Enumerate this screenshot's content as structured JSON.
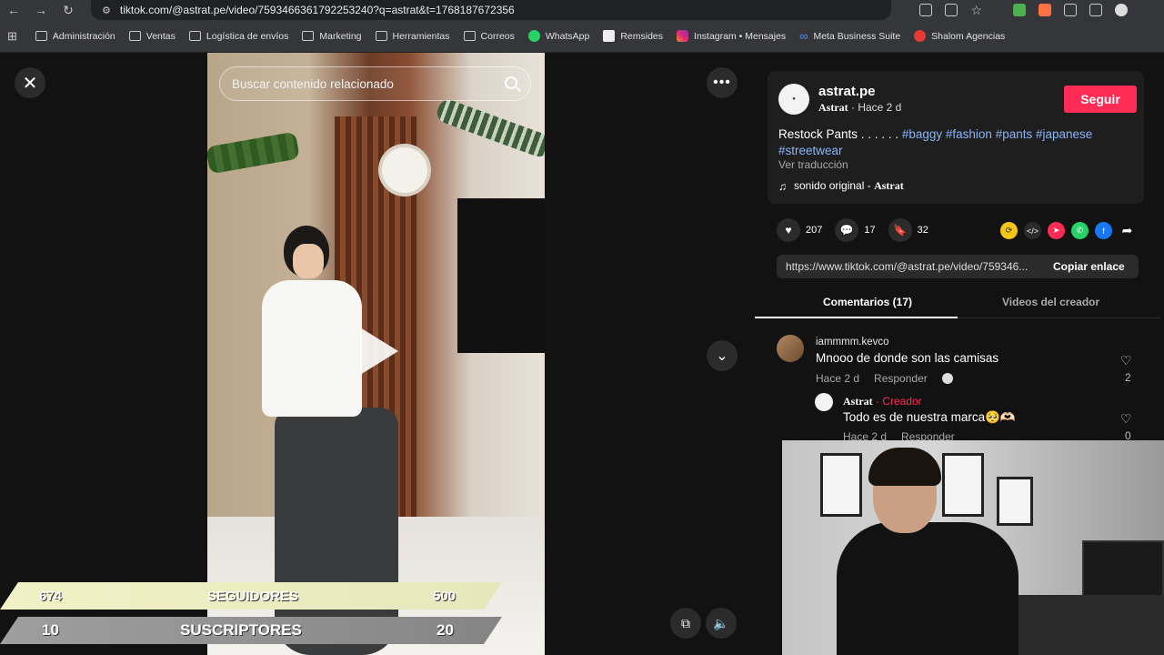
{
  "browser": {
    "url": "tiktok.com/@astrat.pe/video/7593466361792253240?q=astrat&t=1768187672356",
    "bookmarks": [
      "Administración",
      "Ventas",
      "Logística de envíos",
      "Marketing",
      "Herramientas",
      "Correos",
      "WhatsApp",
      "Remsides",
      "Instagram • Mensajes",
      "Meta Business Suite",
      "Shalom Agencias"
    ]
  },
  "video": {
    "search_placeholder": "Buscar contenido relacionado"
  },
  "overlay": {
    "row1": {
      "left": "674",
      "label": "SEGUIDORES",
      "right": "500"
    },
    "row2": {
      "left": "10",
      "label": "SUSCRIPTORES",
      "right": "20"
    }
  },
  "post": {
    "username": "astrat.pe",
    "display_name": "Astrat",
    "time": " · Hace 2 d",
    "follow_label": "Seguir",
    "desc_text": "Restock Pants . . . . . . ",
    "tags": [
      "#baggy",
      "#fashion",
      "#pants",
      "#japanese",
      "#streetwear"
    ],
    "translate": "Ver traducción",
    "sound_text": "sonido original - ",
    "sound_author": "Astrat",
    "likes": "207",
    "comments": "17",
    "saves": "32",
    "link": "https://www.tiktok.com/@astrat.pe/video/759346...",
    "copy_label": "Copiar enlace"
  },
  "tabs": {
    "comments": "Comentarios (17)",
    "creator_videos": "Videos del creador"
  },
  "comments": [
    {
      "user": "iammmm.kevco",
      "text": "Mnooo de donde son las camisas",
      "time": "Hace 2 d",
      "reply_label": "Responder",
      "likes": "2"
    }
  ],
  "reply": {
    "user": "Astrat",
    "creator_tag": " · Creador",
    "text": "Todo es de nuestra marca🥺🫶🏻",
    "time": "Hace 2 d",
    "reply_label": "Responder",
    "likes": "0"
  },
  "colors": {
    "accent": "#fe2c55",
    "tag": "#8ab4f8"
  }
}
